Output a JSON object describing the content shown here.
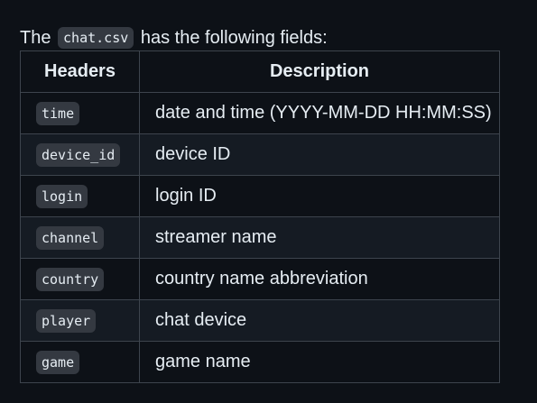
{
  "intro": {
    "prefix": "The",
    "filename": "chat.csv",
    "suffix": "has the following fields:"
  },
  "table": {
    "headers": [
      "Headers",
      "Description"
    ],
    "rows": [
      {
        "field": "time",
        "description": "date and time (YYYY-MM-DD HH:MM:SS)"
      },
      {
        "field": "device_id",
        "description": "device ID"
      },
      {
        "field": "login",
        "description": "login ID"
      },
      {
        "field": "channel",
        "description": "streamer name"
      },
      {
        "field": "country",
        "description": "country name abbreviation"
      },
      {
        "field": "player",
        "description": "chat device"
      },
      {
        "field": "game",
        "description": "game name"
      }
    ]
  }
}
